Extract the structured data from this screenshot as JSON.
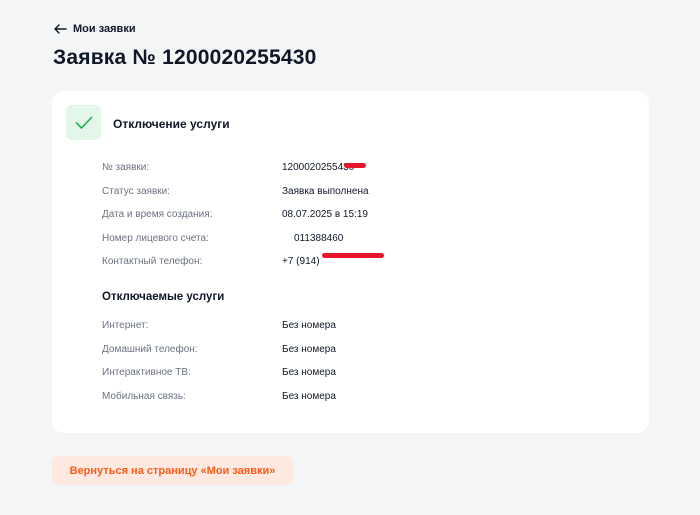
{
  "nav": {
    "back_label": "Мои заявки"
  },
  "page": {
    "title": "Заявка № 1200020255430"
  },
  "card": {
    "title": "Отключение услуги",
    "details": [
      {
        "label": "№ заявки:",
        "value": "1200020255430"
      },
      {
        "label": "Статус заявки:",
        "value": "Заявка выполнена"
      },
      {
        "label": "Дата и время создания:",
        "value": "08.07.2025 в 15:19"
      },
      {
        "label": "Номер лицевого счета:",
        "value": "011388460"
      },
      {
        "label": "Контактный телефон:",
        "value": "+7 (914)"
      }
    ],
    "services_title": "Отключаемые услуги",
    "services": [
      {
        "label": "Интернет:",
        "value": "Без номера"
      },
      {
        "label": "Домашний телефон:",
        "value": "Без номера"
      },
      {
        "label": "Интерактивное ТВ:",
        "value": "Без номера"
      },
      {
        "label": "Мобильная связь:",
        "value": "Без номера"
      }
    ]
  },
  "actions": {
    "return_label": "Вернуться на страницу «Мои заявки»"
  },
  "colors": {
    "accent": "#ff5b1a",
    "accent_bg": "#fde9df",
    "success": "#22b05a",
    "success_bg": "#e3f6ea",
    "redaction": "#e8172c"
  }
}
